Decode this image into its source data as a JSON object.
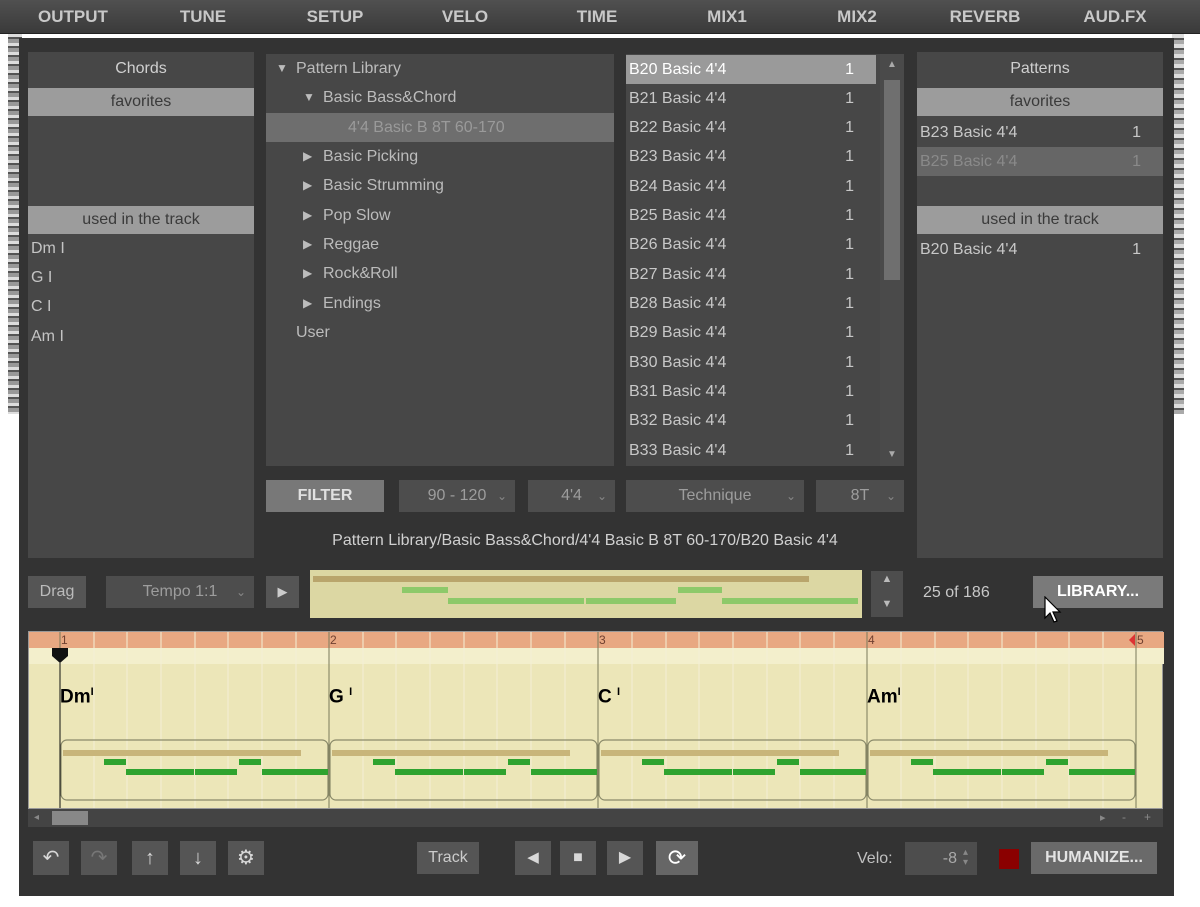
{
  "nav": [
    "OUTPUT",
    "TUNE",
    "SETUP",
    "VELO",
    "TIME",
    "MIX1",
    "MIX2",
    "REVERB",
    "AUD.FX"
  ],
  "chords": {
    "title": "Chords",
    "favorites_label": "favorites",
    "used_label": "used in the track",
    "used": [
      "Dm I",
      "G I",
      "C I",
      "Am I"
    ]
  },
  "tree": [
    {
      "label": "Pattern Library",
      "level": 0,
      "arrow": "down"
    },
    {
      "label": "Basic Bass&Chord",
      "level": 1,
      "arrow": "down"
    },
    {
      "label": "4'4 Basic B 8T 60-170",
      "level": 2,
      "arrow": "",
      "selected": true
    },
    {
      "label": "Basic Picking",
      "level": 1,
      "arrow": "right"
    },
    {
      "label": "Basic Strumming",
      "level": 1,
      "arrow": "right"
    },
    {
      "label": "Pop Slow",
      "level": 1,
      "arrow": "right"
    },
    {
      "label": "Reggae",
      "level": 1,
      "arrow": "right"
    },
    {
      "label": "Rock&Roll",
      "level": 1,
      "arrow": "right"
    },
    {
      "label": "Endings",
      "level": 1,
      "arrow": "right"
    },
    {
      "label": "User",
      "level": 0,
      "arrow": ""
    }
  ],
  "pattern_list": [
    {
      "name": "B20 Basic 4'4",
      "count": "1",
      "selected": true
    },
    {
      "name": "B21 Basic 4'4",
      "count": "1"
    },
    {
      "name": "B22 Basic 4'4",
      "count": "1"
    },
    {
      "name": "B23 Basic 4'4",
      "count": "1"
    },
    {
      "name": "B24 Basic 4'4",
      "count": "1"
    },
    {
      "name": "B25 Basic 4'4",
      "count": "1"
    },
    {
      "name": "B26 Basic 4'4",
      "count": "1"
    },
    {
      "name": "B27 Basic 4'4",
      "count": "1"
    },
    {
      "name": "B28 Basic 4'4",
      "count": "1"
    },
    {
      "name": "B29 Basic 4'4",
      "count": "1"
    },
    {
      "name": "B30 Basic 4'4",
      "count": "1"
    },
    {
      "name": "B31 Basic 4'4",
      "count": "1"
    },
    {
      "name": "B32 Basic 4'4",
      "count": "1"
    },
    {
      "name": "B33 Basic 4'4",
      "count": "1"
    }
  ],
  "patterns": {
    "title": "Patterns",
    "favorites_label": "favorites",
    "favorites": [
      {
        "name": "B23 Basic 4'4",
        "count": "1"
      },
      {
        "name": "B25 Basic 4'4",
        "count": "1",
        "selected": true
      }
    ],
    "used_label": "used in the track",
    "used": [
      {
        "name": "B20 Basic 4'4",
        "count": "1"
      }
    ]
  },
  "filters": {
    "filter_label": "FILTER",
    "tempo_range": "90 - 120",
    "meter": "4'4",
    "technique": "Technique",
    "feel": "8T"
  },
  "path": "Pattern Library/Basic Bass&Chord/4'4 Basic B 8T 60-170/B20 Basic 4'4",
  "preview": {
    "drag_label": "Drag",
    "tempo_label": "Tempo 1:1",
    "position": "25 of 186",
    "library_label": "LIBRARY..."
  },
  "timeline": {
    "bars": [
      "1",
      "2",
      "3",
      "4",
      "5"
    ],
    "chords": [
      {
        "root": "Dm",
        "mark": "I"
      },
      {
        "root": "G",
        "mark": "I"
      },
      {
        "root": "C",
        "mark": "I"
      },
      {
        "root": "Am",
        "mark": "I"
      }
    ]
  },
  "transport": {
    "track_label": "Track",
    "velo_label": "Velo:",
    "velo_value": "-8",
    "humanize_label": "HUMANIZE..."
  },
  "colors": {
    "accent_red": "#8b0000",
    "note_green": "#2fa32f",
    "note_bar": "#b8a56a",
    "ruler": "#e8a882",
    "grid_bg": "#ece6b8"
  }
}
